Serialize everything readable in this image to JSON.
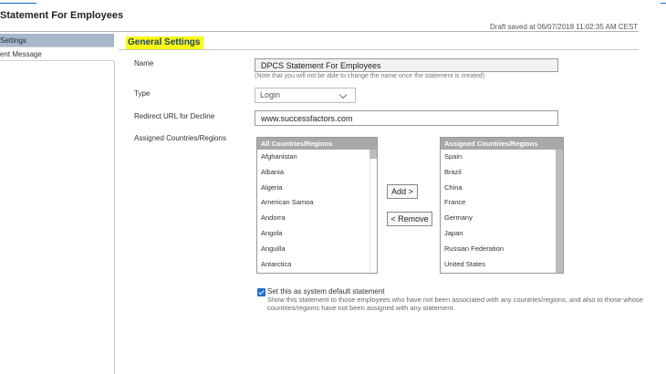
{
  "page": {
    "title": "Statement For Employees",
    "draft_status": "Draft saved at 06/07/2018 11:02:35 AM CEST"
  },
  "nav": {
    "items": [
      {
        "label": "Settings",
        "active": true
      },
      {
        "label": "ent Message",
        "active": false
      }
    ]
  },
  "section": {
    "title": "General Settings"
  },
  "form": {
    "name_label": "Name",
    "name_value": "DPCS Statement For Employees",
    "name_note": "(Note that you will not be able to change the name once the statement is created)",
    "type_label": "Type",
    "type_value": "Login",
    "redirect_label": "Redirect URL for Decline",
    "redirect_value": "www.successfactors.com",
    "countries_label": "Assigned Countries/Regions"
  },
  "all_countries": {
    "header": "All Countries/Regions",
    "items": [
      "Afghanistan",
      "Albania",
      "Algeria",
      "American Samoa",
      "Andorra",
      "Angola",
      "Anguilla",
      "Antarctica"
    ]
  },
  "assigned_countries": {
    "header": "Assigned Countries/Regions",
    "items": [
      "Spain",
      "Brazil",
      "China",
      "France",
      "Germany",
      "Japan",
      "Russian Federation",
      "United States"
    ]
  },
  "buttons": {
    "add": "Add >",
    "remove": "< Remove"
  },
  "default_statement": {
    "checked": true,
    "label": "Set this as system default statement",
    "description": "Show this statement to those employees who have not been associated with any countries/regions, and also to those whose countries/regions have not been assigned with any statement."
  }
}
